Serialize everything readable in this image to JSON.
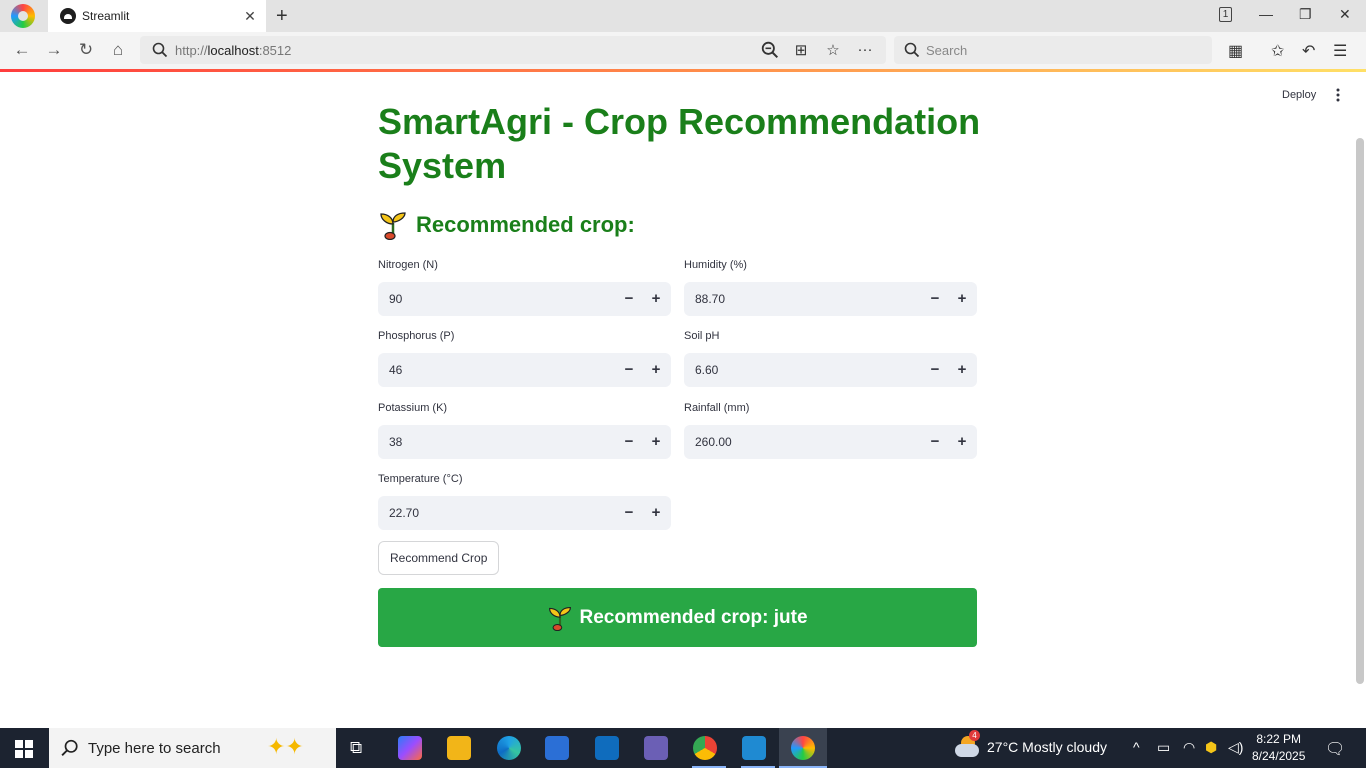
{
  "browser": {
    "tab_title": "Streamlit",
    "tab_count": "1",
    "url_prefix": "http://",
    "url_host": "localhost",
    "url_port": ":8512",
    "search_placeholder": "Search"
  },
  "app": {
    "deploy_label": "Deploy",
    "title": "SmartAgri - Crop Recommendation System",
    "subheader": "Recommended crop:",
    "fields": [
      {
        "label": "Nitrogen (N)",
        "value": "90"
      },
      {
        "label": "Humidity (%)",
        "value": "88.70"
      },
      {
        "label": "Phosphorus (P)",
        "value": "46"
      },
      {
        "label": "Soil pH",
        "value": "6.60"
      },
      {
        "label": "Potassium (K)",
        "value": "38"
      },
      {
        "label": "Rainfall (mm)",
        "value": "260.00"
      },
      {
        "label": "Temperature (°C)",
        "value": "22.70"
      }
    ],
    "stepper_minus": "−",
    "stepper_plus": "+",
    "button_label": "Recommend Crop",
    "result_text": "Recommended crop: jute",
    "accent_color": "#1a7f1a",
    "result_color": "#28a745"
  },
  "taskbar": {
    "search_placeholder": "Type here to search",
    "weather_badge": "4",
    "weather_text": "27°C  Mostly cloudy",
    "time": "8:22 PM",
    "date": "8/24/2025"
  }
}
